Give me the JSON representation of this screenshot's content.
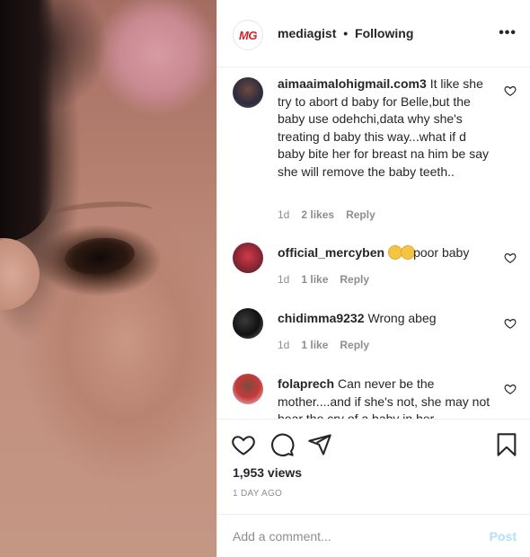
{
  "header": {
    "logo_text": "MG",
    "username": "mediagist",
    "separator": "•",
    "follow_status": "Following",
    "more_label": "•••"
  },
  "comments": [
    {
      "username": "aimaaimalohigmail.com3",
      "text": "It like she try to abort d baby for Belle,but the baby use odehchi,data why she's treating d baby this way...what if d baby bite her for breast na him be say she will remove the baby teeth..",
      "time": "1d",
      "likes": "2 likes",
      "reply": "Reply"
    },
    {
      "username": "official_mercyben",
      "text_suffix": "poor baby",
      "emojis": [
        "crying-face",
        "crying-face"
      ],
      "time": "1d",
      "likes": "1 like",
      "reply": "Reply"
    },
    {
      "username": "chidimma9232",
      "text": "Wrong abeg",
      "time": "1d",
      "likes": "1 like",
      "reply": "Reply"
    },
    {
      "username": "folaprech",
      "text": "Can never be the mother....and if she's not, she may not hear the cry of a baby in her",
      "time": "",
      "likes": "",
      "reply": ""
    }
  ],
  "actions": {
    "icons": [
      "heart-icon",
      "comment-icon",
      "share-icon",
      "bookmark-icon"
    ],
    "views": "1,953 views",
    "time_ago": "1 DAY AGO"
  },
  "add_comment": {
    "placeholder": "Add a comment...",
    "post_label": "Post"
  },
  "colors": {
    "text": "#262626",
    "muted": "#8e8e8e",
    "post_disabled": "#b2dffc",
    "border": "#efefef",
    "logo_red": "#d3232a"
  }
}
